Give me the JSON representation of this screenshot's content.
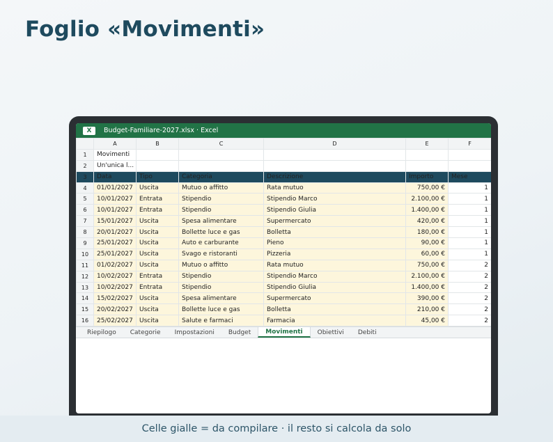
{
  "page": {
    "title": "Foglio «Movimenti»",
    "footer": "Celle gialle = da compilare · il resto si calcola da solo"
  },
  "window": {
    "icon_label": "X",
    "title": "Budget-Familiare-2027.xlsx · Excel"
  },
  "sheet": {
    "columns": [
      "A",
      "B",
      "C",
      "D",
      "E",
      "F"
    ],
    "row_numbers": [
      "1",
      "2",
      "3",
      "4",
      "5",
      "6",
      "7",
      "8",
      "9",
      "10",
      "11",
      "12",
      "13",
      "14",
      "15",
      "16"
    ],
    "title": "Movimenti",
    "subtitle": "Un'unica l...",
    "headers": [
      "Data",
      "Tipo",
      "Categoria",
      "Descrizione",
      "Importo",
      "Mese"
    ],
    "rows": [
      [
        "01/01/2027",
        "Uscita",
        "Mutuo o affitto",
        "Rata mutuo",
        "750,00 €",
        "1"
      ],
      [
        "10/01/2027",
        "Entrata",
        "Stipendio",
        "Stipendio Marco",
        "2.100,00 €",
        "1"
      ],
      [
        "10/01/2027",
        "Entrata",
        "Stipendio",
        "Stipendio Giulia",
        "1.400,00 €",
        "1"
      ],
      [
        "15/01/2027",
        "Uscita",
        "Spesa alimentare",
        "Supermercato",
        "420,00 €",
        "1"
      ],
      [
        "20/01/2027",
        "Uscita",
        "Bollette luce e gas",
        "Bolletta",
        "180,00 €",
        "1"
      ],
      [
        "25/01/2027",
        "Uscita",
        "Auto e carburante",
        "Pieno",
        "90,00 €",
        "1"
      ],
      [
        "25/01/2027",
        "Uscita",
        "Svago e ristoranti",
        "Pizzeria",
        "60,00 €",
        "1"
      ],
      [
        "01/02/2027",
        "Uscita",
        "Mutuo o affitto",
        "Rata mutuo",
        "750,00 €",
        "2"
      ],
      [
        "10/02/2027",
        "Entrata",
        "Stipendio",
        "Stipendio Marco",
        "2.100,00 €",
        "2"
      ],
      [
        "10/02/2027",
        "Entrata",
        "Stipendio",
        "Stipendio Giulia",
        "1.400,00 €",
        "2"
      ],
      [
        "15/02/2027",
        "Uscita",
        "Spesa alimentare",
        "Supermercato",
        "390,00 €",
        "2"
      ],
      [
        "20/02/2027",
        "Uscita",
        "Bollette luce e gas",
        "Bolletta",
        "210,00 €",
        "2"
      ],
      [
        "25/02/2027",
        "Uscita",
        "Salute e farmaci",
        "Farmacia",
        "45,00 €",
        "2"
      ]
    ]
  },
  "tabs": [
    "Riepilogo",
    "Categorie",
    "Impostazioni",
    "Budget",
    "Movimenti",
    "Obiettivi",
    "Debiti"
  ],
  "active_tab": "Movimenti",
  "colors": {
    "excel_green": "#217346",
    "header_navy": "#1e4a5e",
    "input_yellow": "#fdf6dc"
  }
}
